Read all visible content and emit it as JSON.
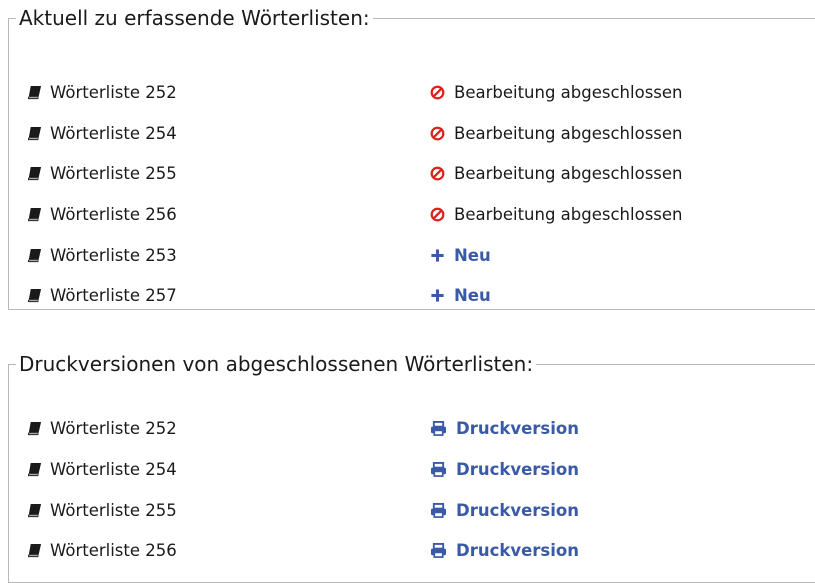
{
  "section_current": {
    "legend": "Aktuell zu erfassende Wörterlisten:",
    "items": [
      {
        "label": "Wörterliste 252",
        "status": "Bearbeitung abgeschlossen",
        "status_type": "closed"
      },
      {
        "label": "Wörterliste 254",
        "status": "Bearbeitung abgeschlossen",
        "status_type": "closed"
      },
      {
        "label": "Wörterliste 255",
        "status": "Bearbeitung abgeschlossen",
        "status_type": "closed"
      },
      {
        "label": "Wörterliste 256",
        "status": "Bearbeitung abgeschlossen",
        "status_type": "closed"
      },
      {
        "label": "Wörterliste 253",
        "status": "Neu",
        "status_type": "new"
      },
      {
        "label": "Wörterliste 257",
        "status": "Neu",
        "status_type": "new"
      }
    ]
  },
  "section_print": {
    "legend": "Druckversionen von abgeschlossenen Wörterlisten:",
    "items": [
      {
        "label": "Wörterliste 252",
        "action": "Druckversion"
      },
      {
        "label": "Wörterliste 254",
        "action": "Druckversion"
      },
      {
        "label": "Wörterliste 255",
        "action": "Druckversion"
      },
      {
        "label": "Wörterliste 256",
        "action": "Druckversion"
      }
    ]
  },
  "colors": {
    "link": "#3a5aa8",
    "closed_icon": "#e0201b",
    "border": "#b8b8b8"
  },
  "icons": {
    "list_item": "book-icon",
    "closed": "ban-icon",
    "new": "plus-icon",
    "print": "print-icon"
  }
}
